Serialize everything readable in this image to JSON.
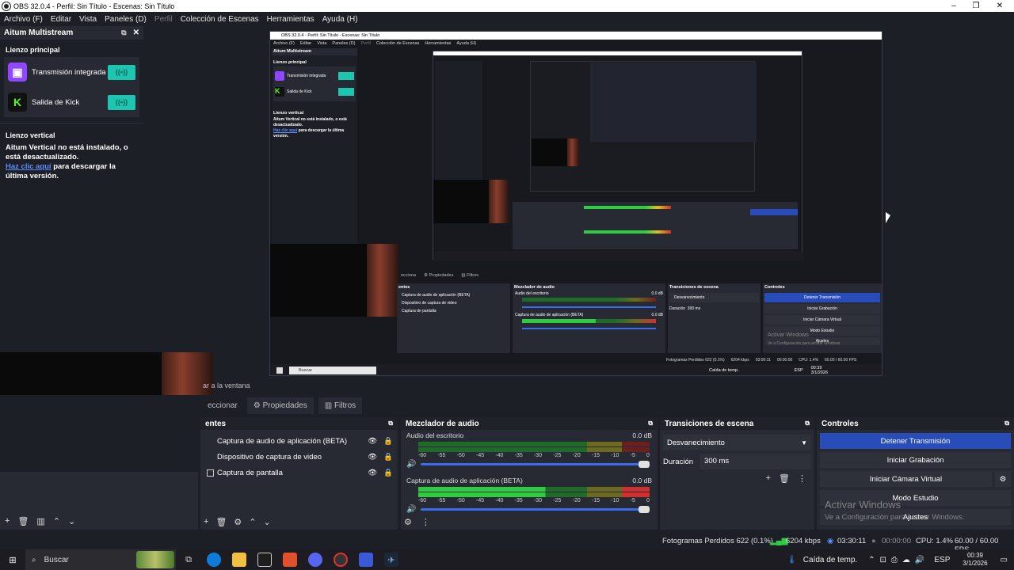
{
  "window": {
    "title": "OBS 32.0.4 - Perfil: Sin Título - Escenas: Sin Título",
    "controls": [
      "–",
      "❐",
      "✕"
    ]
  },
  "menu": [
    "Archivo (F)",
    "Editar",
    "Vista",
    "Paneles (D)",
    "Perfil",
    "Colección de Escenas",
    "Herramientas",
    "Ayuda (H)"
  ],
  "dock": {
    "title": "Aitum Multistream",
    "main_canvas_title": "Lienzo principal",
    "outputs": [
      {
        "name": "Transmisión integrada",
        "icon": "twitch-icon",
        "color": "#9146ff"
      },
      {
        "name": "Salida de Kick",
        "icon": "kick-icon",
        "color": "#53fc18"
      }
    ],
    "vertical_title": "Lienzo vertical",
    "vertical_msg": "Aitum Vertical no está instalado, o está desactualizado.",
    "vertical_link": "Haz clic aquí",
    "vertical_link_suffix": " para descargar la última versión."
  },
  "nested": {
    "title": "OBS 32.0.4 - Perfil: Sin Título - Escenas: Sin Título",
    "menu": [
      "Archivo (F)",
      "Editar",
      "Vista",
      "Paneles (D)",
      "Perfil",
      "Colección de Escenas",
      "Herramientas",
      "Ayuda (H)"
    ],
    "dock_title": "Aitum Multistream",
    "main_canvas": "Lienzo principal",
    "outputs": [
      "Transmisión integrada",
      "Salida de Kick"
    ],
    "vertical_title": "Lienzo vertical",
    "vertical_msg": "Aitum Vertical no está instalado, o está desactualizado.",
    "vertical_link": "Haz clic aquí",
    "vertical_link_suffix": " para descargar la última versión.",
    "tabs": [
      "ecciona",
      "Propiedades",
      "Filtros"
    ],
    "sources_title": "entes",
    "sources": [
      "Captura de audio de aplicación (BETA)",
      "Dispositivo de captura de video",
      "Captura de pantalla"
    ],
    "mixer_title": "Mezclador de audio",
    "mixer_ch1": "Audio del escritorio",
    "mixer_ch2": "Captura de audio de aplicación (BETA)",
    "db": "0.0 dB",
    "transitions_title": "Transiciones de escena",
    "transition": "Desvanecimiento",
    "duration_label": "Duración",
    "duration": "300 ms",
    "controls_title": "Controles",
    "controls": [
      "Detener Transmisión",
      "Iniciar Grabación",
      "Iniciar Cámara Virtual",
      "Modo Estudio",
      "Ajustes"
    ],
    "status": "Fotogramas Perdidos 622 (0.1%)",
    "kbps": "6204 kbps",
    "time1": "03:00:11",
    "time2": "00:00:00",
    "cpu": "CPU: 1.4%",
    "fps": "60.00 / 60.00 FPS",
    "search": "Buscar",
    "weather": "Caída de temp.",
    "lang": "ESP",
    "clock": "00:39",
    "date": "3/1/2026",
    "activate": "Activar Windows",
    "activate_sub": "Ve a Configuración para activar Windows."
  },
  "window_capture_hint": "ar a la ventana",
  "tabs": [
    "eccionar",
    "Propiedades",
    "Filtros"
  ],
  "sources": {
    "title": "entes",
    "items": [
      "Captura de audio de aplicación (BETA)",
      "Dispositivo de captura de video",
      "Captura de pantalla"
    ]
  },
  "mixer": {
    "title": "Mezclador de audio",
    "channels": [
      {
        "name": "Audio del escritorio",
        "db": "0.0 dB",
        "level": 0.0
      },
      {
        "name": "Captura de audio de aplicación (BETA)",
        "db": "0.0 dB",
        "level": 0.55
      }
    ],
    "scale": [
      "-60",
      "-55",
      "-50",
      "-45",
      "-40",
      "-35",
      "-30",
      "-25",
      "-20",
      "-15",
      "-10",
      "-5",
      "0"
    ]
  },
  "transitions": {
    "title": "Transiciones de escena",
    "selected": "Desvanecimiento",
    "duration_label": "Duración",
    "duration": "300 ms"
  },
  "controls": {
    "title": "Controles",
    "stop_stream": "Detener Transmisión",
    "start_record": "Iniciar Grabación",
    "start_virtualcam": "Iniciar Cámara Virtual",
    "studio_mode": "Modo Estudio",
    "settings": "Ajustes"
  },
  "watermark": {
    "title": "Activar Windows",
    "subtitle": "Ve a Configuración para activar Windows."
  },
  "status": {
    "dropped": "Fotogramas Perdidos 622 (0.1%)",
    "kbps": "6204 kbps",
    "stream_time": "03:30:11",
    "record_time": "00:00:00",
    "cpu": "CPU: 1.4%",
    "fps": "60.00 / 60.00 FPS"
  },
  "taskbar": {
    "search": "Buscar",
    "weather": "Caída de temp.",
    "lang": "ESP",
    "time": "00:39",
    "date": "3/1/2026"
  },
  "colors": {
    "accent": "#284cb8",
    "live_button": "#1cc6b0",
    "panel_bg": "#272a33",
    "app_bg": "#1d1f26"
  }
}
